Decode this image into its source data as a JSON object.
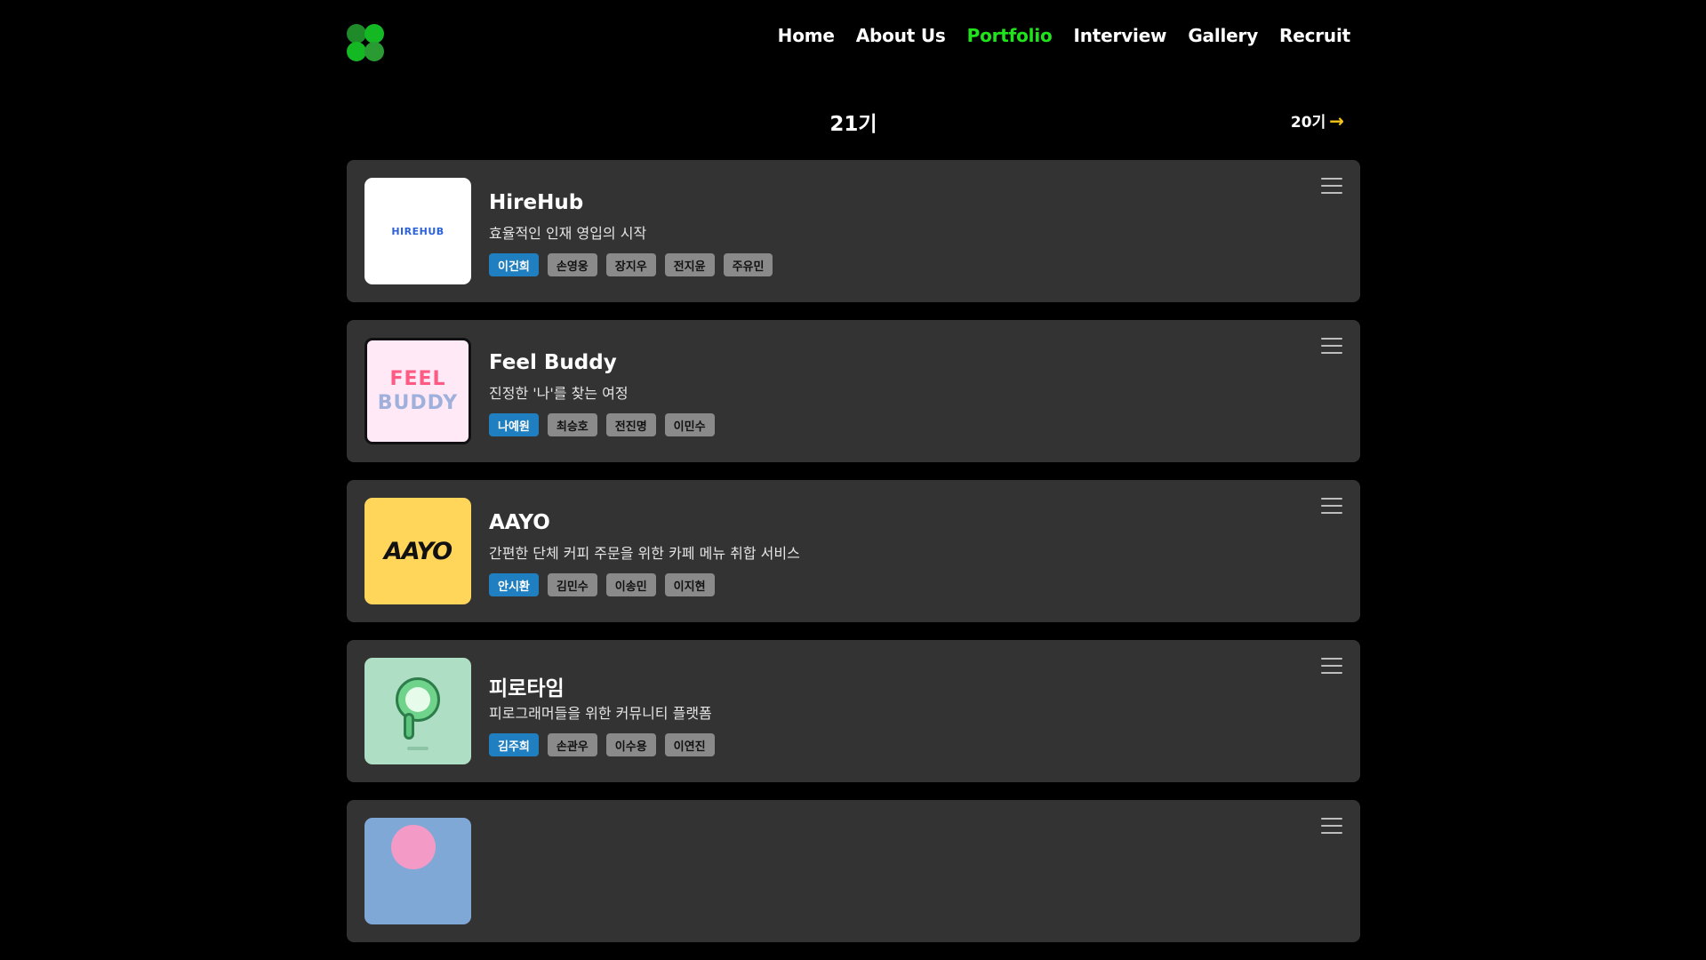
{
  "nav": {
    "items": [
      "Home",
      "About Us",
      "Portfolio",
      "Interview",
      "Gallery",
      "Recruit"
    ],
    "active": "Portfolio"
  },
  "generation": {
    "current": "21기",
    "next_link": "20기",
    "arrow_color": "#f5c518"
  },
  "colors": {
    "accent_green": "#1fe31b",
    "leader_tag": "#1f7fc0",
    "member_tag": "#8a8a8a",
    "card_bg": "#333333"
  },
  "projects": [
    {
      "logo_text": "HIREHUB",
      "title": "HireHub",
      "description": "효율적인 인재 영입의 시작",
      "leader": "이건희",
      "members": [
        "손영웅",
        "장지우",
        "전지윤",
        "주유민"
      ]
    },
    {
      "logo_text": "FEEL BUDDY",
      "title": "Feel Buddy",
      "description": "진정한 '나'를 찾는 여정",
      "leader": "나예원",
      "members": [
        "최승호",
        "전진명",
        "이민수"
      ]
    },
    {
      "logo_text": "AAYO",
      "title": "AAYO",
      "description": "간편한 단체 커피 주문을 위한 카페 메뉴 취합 서비스",
      "leader": "안시환",
      "members": [
        "김민수",
        "이송민",
        "이지현"
      ]
    },
    {
      "title": "피로타임",
      "description": "피로그래머들을 위한 커뮤니티 플랫폼",
      "leader": "김주희",
      "members": [
        "손관우",
        "이수용",
        "이연진"
      ]
    },
    {
      "title": "",
      "description": "",
      "leader": "",
      "members": []
    }
  ]
}
